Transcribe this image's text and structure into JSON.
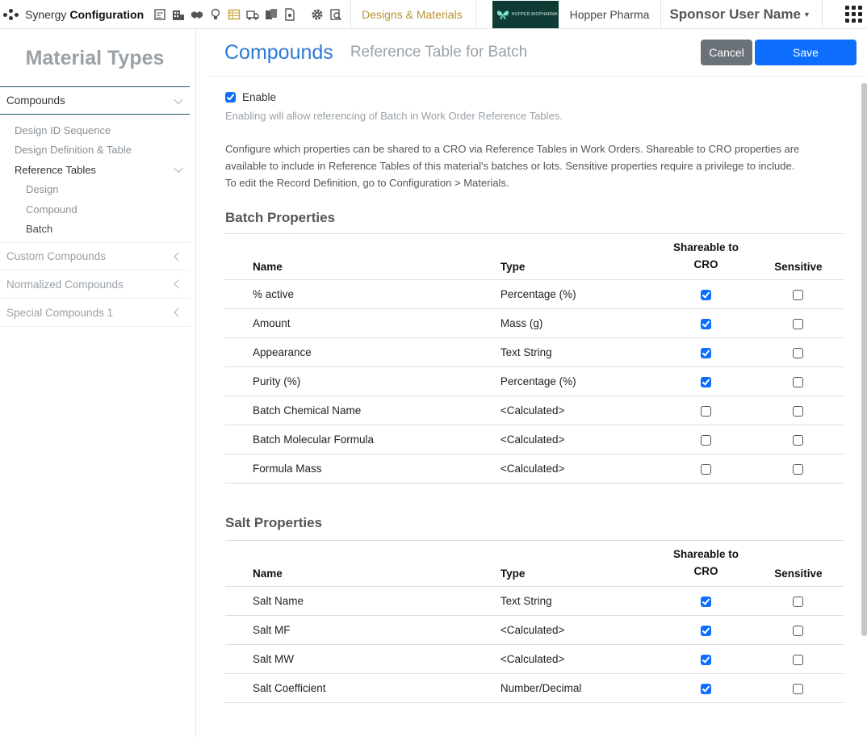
{
  "topbar": {
    "brand_name": "Synergy",
    "brand_section": "Configuration",
    "module": "Designs & Materials",
    "logo_text": "HOPPER BIOPHARMA",
    "org": "Hopper Pharma",
    "user": "Sponsor User Name",
    "icons": [
      "report-icon",
      "building-icon",
      "handshake-icon",
      "lightbulb-icon",
      "table-icon",
      "truck-icon",
      "documents-icon",
      "file-icon",
      "gear-icon",
      "settings-search-icon"
    ]
  },
  "sidebar": {
    "title": "Material Types",
    "items": [
      {
        "label": "Compounds",
        "active": true
      },
      {
        "label": "Custom Compounds"
      },
      {
        "label": "Normalized Compounds"
      },
      {
        "label": "Special Compounds 1"
      }
    ],
    "compounds_sub": [
      "Design ID Sequence",
      "Design Definition & Table",
      "Reference Tables"
    ],
    "reference_tables_sub": [
      "Design",
      "Compound",
      "Batch"
    ]
  },
  "header": {
    "title": "Compounds",
    "subtitle": "Reference Table for Batch",
    "cancel_label": "Cancel",
    "save_label": "Save"
  },
  "content": {
    "enable_label": "Enable",
    "enabled": true,
    "enable_hint": "Enabling will allow referencing of Batch in Work Order Reference Tables.",
    "description_lines": [
      "Configure which properties can be shared to a CRO via Reference Tables in Work Orders. Shareable to CRO properties are",
      "available to include in Reference Tables of this material's batches or lots. Sensitive properties require a privilege to include.",
      "To edit the Record Definition, go to Configuration > Materials."
    ]
  },
  "columns": {
    "name": "Name",
    "type": "Type",
    "cro_line1": "Shareable to",
    "cro_line2": "CRO",
    "sensitive": "Sensitive"
  },
  "batch": {
    "title": "Batch Properties",
    "rows": [
      {
        "name": "% active",
        "type": "Percentage (%)",
        "cro": true,
        "sensitive": false
      },
      {
        "name": "Amount",
        "type": "Mass (g)",
        "cro": true,
        "sensitive": false
      },
      {
        "name": "Appearance",
        "type": "Text String",
        "cro": true,
        "sensitive": false
      },
      {
        "name": "Purity (%)",
        "type": "Percentage (%)",
        "cro": true,
        "sensitive": false
      },
      {
        "name": "Batch Chemical Name",
        "type": "<Calculated>",
        "cro": false,
        "sensitive": false
      },
      {
        "name": "Batch Molecular Formula",
        "type": "<Calculated>",
        "cro": false,
        "sensitive": false
      },
      {
        "name": "Formula Mass",
        "type": "<Calculated>",
        "cro": false,
        "sensitive": false
      }
    ]
  },
  "salt": {
    "title": "Salt Properties",
    "rows": [
      {
        "name": "Salt Name",
        "type": "Text String",
        "cro": true,
        "sensitive": false
      },
      {
        "name": "Salt MF",
        "type": "<Calculated>",
        "cro": true,
        "sensitive": false
      },
      {
        "name": "Salt MW",
        "type": "<Calculated>",
        "cro": true,
        "sensitive": false
      },
      {
        "name": "Salt Coefficient",
        "type": "Number/Decimal",
        "cro": true,
        "sensitive": false
      }
    ]
  }
}
